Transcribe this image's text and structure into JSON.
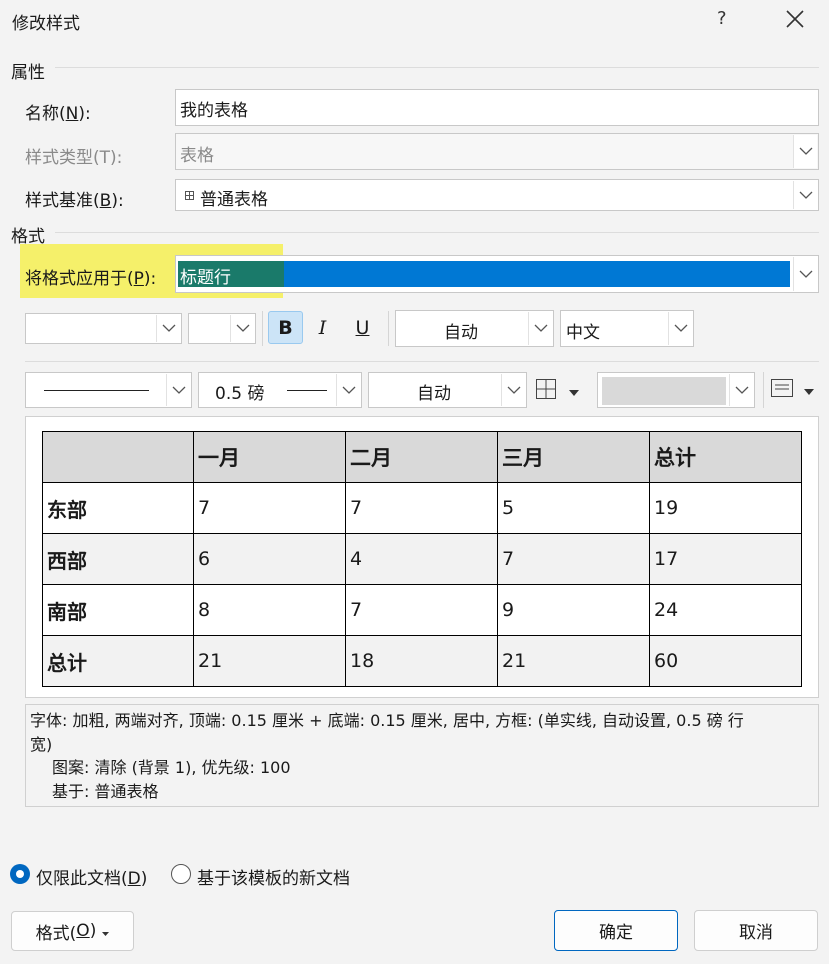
{
  "window": {
    "title": "修改样式",
    "help": "?"
  },
  "properties": {
    "section": "属性",
    "name_label_prefix": "名称(",
    "name_label_key": "N",
    "name_label_suffix": "):",
    "name_value": "我的表格",
    "type_label": "样式类型(T):",
    "type_value": "表格",
    "base_label_prefix": "样式基准(",
    "base_label_key": "B",
    "base_label_suffix": "):",
    "base_value": "普通表格"
  },
  "format": {
    "section": "格式",
    "apply_label_prefix": "将格式应用于(",
    "apply_label_key": "P",
    "apply_label_suffix": "):",
    "apply_value": "标题行"
  },
  "toolbar1": {
    "font_name": "",
    "font_size": "",
    "bold": "B",
    "italic": "I",
    "underline": "U",
    "color": "自动",
    "script": "中文"
  },
  "toolbar2": {
    "line_weight": "0.5 磅",
    "border_color": "自动"
  },
  "preview": {
    "rows": [
      [
        "",
        "一月",
        "二月",
        "三月",
        "总计"
      ],
      [
        "东部",
        "7",
        "7",
        "5",
        "19"
      ],
      [
        "西部",
        "6",
        "4",
        "7",
        "17"
      ],
      [
        "南部",
        "8",
        "7",
        "9",
        "24"
      ],
      [
        "总计",
        "21",
        "18",
        "21",
        "60"
      ]
    ]
  },
  "description": {
    "line1": "字体: 加粗, 两端对齐, 顶端:  0.15 厘米 + 底端:  0.15 厘米, 居中, 方框: (单实线, 自动设置,  0.5 磅 行",
    "line2": "宽)",
    "line3": "图案: 清除 (背景 1), 优先级: 100",
    "line4": "基于: 普通表格"
  },
  "scope": {
    "only_doc_prefix": "仅限此文档(",
    "only_doc_key": "D",
    "only_doc_suffix": ")",
    "template": "基于该模板的新文档",
    "selected": "only_doc"
  },
  "buttons": {
    "format_prefix": "格式(",
    "format_key": "O",
    "format_suffix": ")",
    "ok": "确定",
    "cancel": "取消"
  },
  "colors": {
    "accent": "#0078d4",
    "highlight": "#f5f06a",
    "selection": "#0078d4"
  }
}
